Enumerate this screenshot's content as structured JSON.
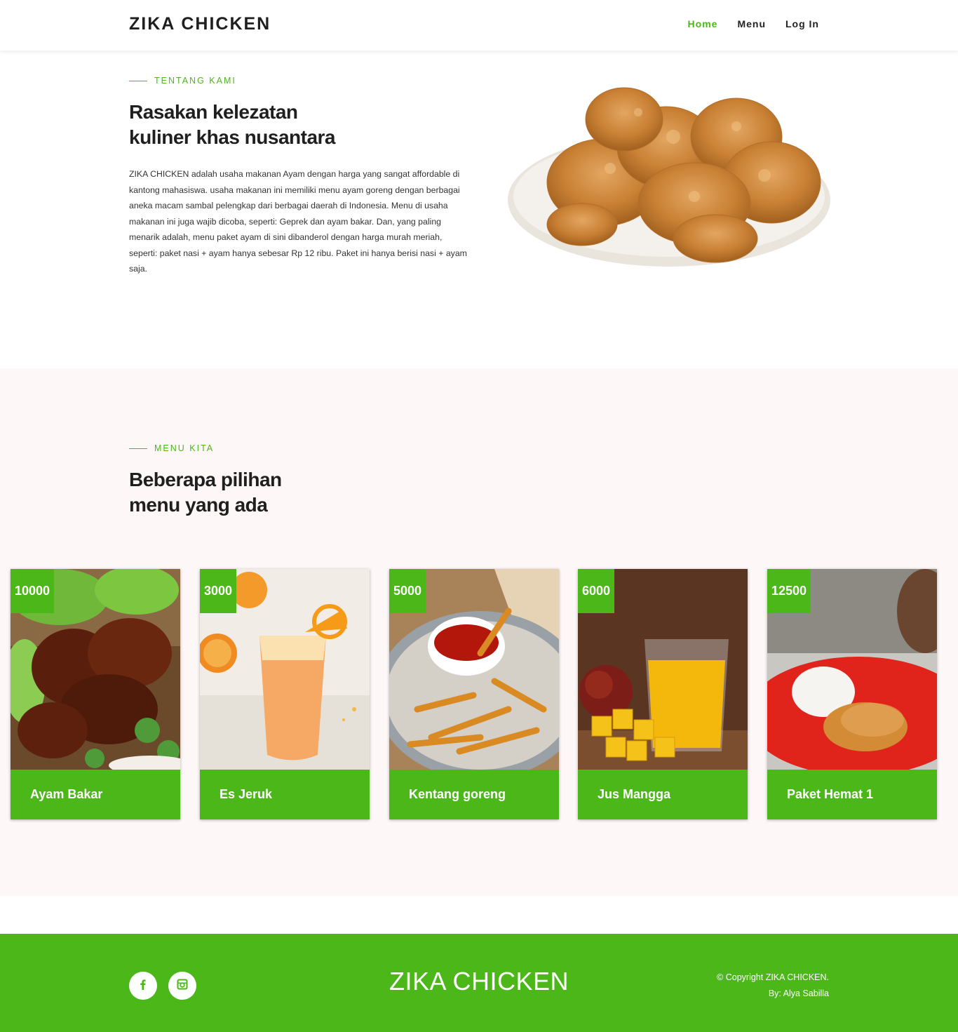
{
  "header": {
    "brand": "ZIKA CHICKEN",
    "nav": [
      {
        "label": "Home",
        "active": true
      },
      {
        "label": "Menu",
        "active": false
      },
      {
        "label": "Log In",
        "active": false
      }
    ]
  },
  "about": {
    "eyebrow": "TENTANG KAMI",
    "title_line1": "Rasakan kelezatan",
    "title_line2": "kuliner khas nusantara",
    "text": "ZIKA CHICKEN adalah usaha makanan Ayam dengan harga yang sangat affordable di kantong mahasiswa. usaha makanan ini memiliki menu ayam goreng dengan berbagai aneka macam sambal pelengkap dari berbagai daerah di Indonesia. Menu di usaha makanan ini juga wajib dicoba, seperti: Geprek dan ayam bakar. Dan, yang paling menarik adalah, menu paket ayam di sini dibanderol dengan harga murah meriah, seperti: paket nasi + ayam hanya sebesar Rp 12 ribu. Paket ini hanya berisi nasi + ayam saja."
  },
  "menu": {
    "eyebrow": "MENU KITA",
    "title_line1": "Beberapa pilihan",
    "title_line2": "menu yang ada",
    "items": [
      {
        "price": "10000",
        "name": "Ayam Bakar"
      },
      {
        "price": "3000",
        "name": "Es Jeruk"
      },
      {
        "price": "5000",
        "name": "Kentang goreng"
      },
      {
        "price": "6000",
        "name": "Jus Mangga"
      },
      {
        "price": "12500",
        "name": "Paket Hemat 1"
      }
    ]
  },
  "footer": {
    "brand": "ZIKA CHICKEN",
    "copyright": "© Copyright ZIKA CHICKEN.",
    "author": "By: Alya Sabilla"
  },
  "colors": {
    "accent": "#4cb718",
    "section_bg": "#fdf8f7"
  },
  "icons": [
    "facebook-icon",
    "instagram-icon"
  ]
}
